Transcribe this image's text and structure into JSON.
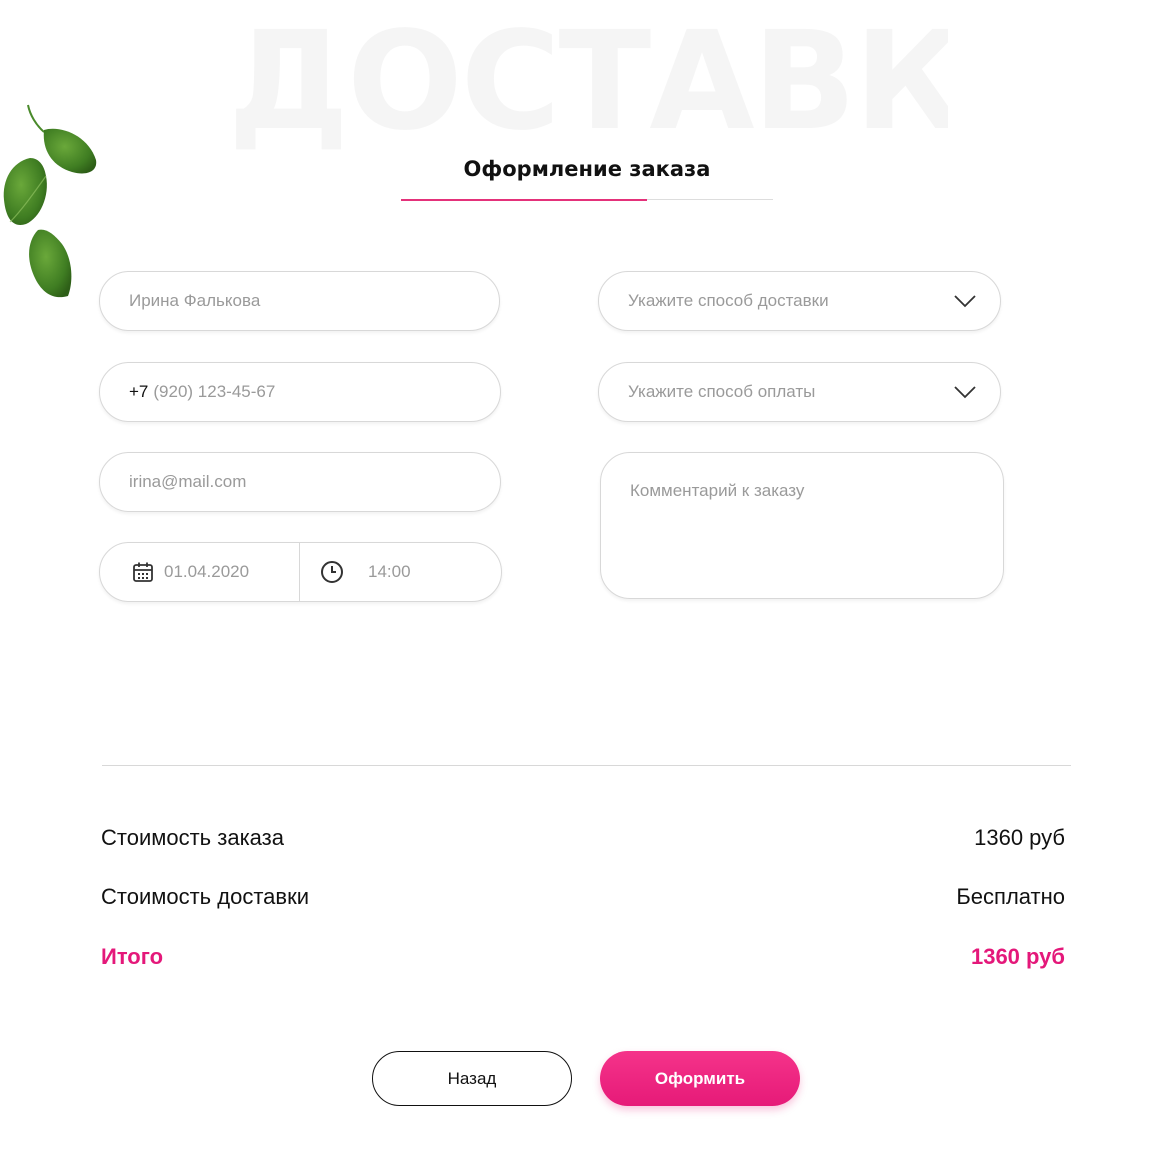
{
  "background_title": "ДОСТАВКА",
  "heading": "Оформление заказа",
  "heading_progress_percent": 66,
  "form": {
    "name_placeholder": "Ирина Фалькова",
    "phone_prefix": "+7",
    "phone_placeholder": "(920) 123-45-67",
    "email_placeholder": "irina@mail.com",
    "date_placeholder": "01.04.2020",
    "time_placeholder": "14:00",
    "delivery_select": "Укажите способ доставки",
    "payment_select": "Укажите способ оплаты",
    "comment_placeholder": "Комментарий к заказу"
  },
  "summary": {
    "order_cost_label": "Стоимость заказа",
    "order_cost_value": "1360 руб",
    "delivery_cost_label": "Стоимость доставки",
    "delivery_cost_value": "Бесплатно",
    "total_label": "Итого",
    "total_value": "1360 руб"
  },
  "buttons": {
    "back": "Назад",
    "submit": "Оформить"
  },
  "colors": {
    "accent": "#e4187a",
    "border": "#d8d8d8",
    "placeholder": "#9a9a9a"
  },
  "icons": [
    "calendar-icon",
    "clock-icon",
    "chevron-down-icon",
    "spinach-leaves"
  ]
}
